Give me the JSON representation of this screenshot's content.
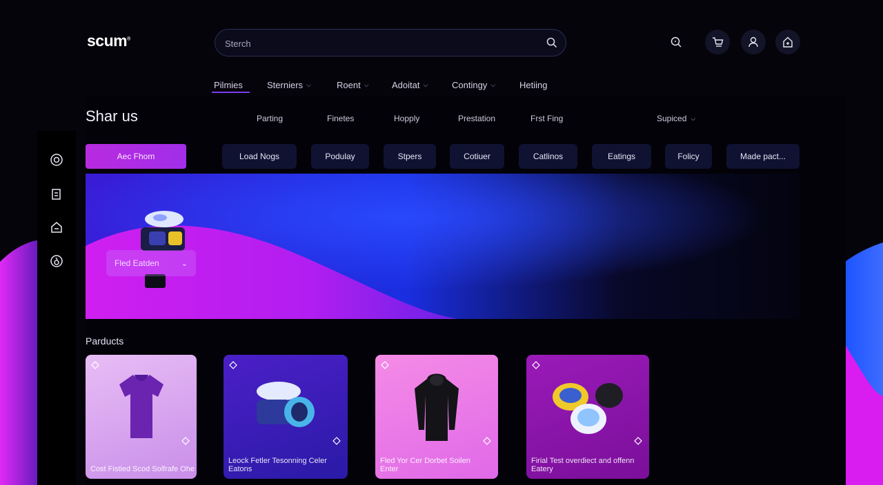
{
  "brand": {
    "logo": "scum"
  },
  "search": {
    "placeholder": "Sterch"
  },
  "header_icons": [
    "zoom-icon",
    "cart-icon",
    "user-icon",
    "home-icon"
  ],
  "nav": {
    "items": [
      {
        "label": "Pilmies",
        "has_dropdown": false,
        "active": true
      },
      {
        "label": "Sterniers",
        "has_dropdown": true
      },
      {
        "label": "Roent",
        "has_dropdown": true
      },
      {
        "label": "Adoitat",
        "has_dropdown": true
      },
      {
        "label": "Contingy",
        "has_dropdown": true
      },
      {
        "label": "Hetiing",
        "has_dropdown": false
      }
    ]
  },
  "section": {
    "title": "Shar us",
    "subtabs": [
      "Parting",
      "Finetes",
      "Hopply",
      "Prestation",
      "Frst Fing"
    ],
    "sort_label": "Supiced"
  },
  "actions": {
    "primary_label": "Aec Fhom",
    "chips": [
      "Load Nogs",
      "Podulay",
      "Stpers",
      "Cotiuer",
      "Catlinos",
      "Eatings",
      "Folicy",
      "Made pact..."
    ]
  },
  "sidebar": {
    "icons": [
      "target-icon",
      "document-icon",
      "home-icon",
      "info-icon"
    ]
  },
  "hero": {
    "dropdown_label": "Fled Eatden"
  },
  "products": {
    "title": "Parducts",
    "items": [
      {
        "caption": "Cost Fistied Scod Solfrafe Ohe",
        "image": "tshirt"
      },
      {
        "caption": "Leock Fetler Tesonning Celer Eatons",
        "image": "containers"
      },
      {
        "caption": "Fled Yor Cer Dorbet Soilen Enter",
        "image": "hoodie"
      },
      {
        "caption": "Firial Test overdiect and offenn Eatery",
        "image": "jars"
      }
    ]
  },
  "colors": {
    "accent": "#b82be0",
    "background": "#05040b",
    "chip": "#101232",
    "wave_magenta": "#c21af0",
    "wave_blue": "#2a3bf2"
  }
}
